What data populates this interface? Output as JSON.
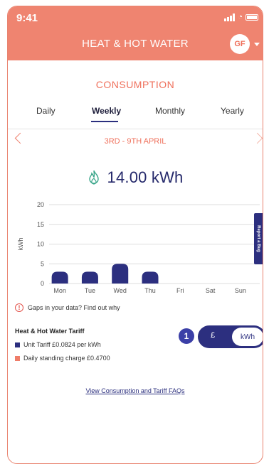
{
  "status_bar": {
    "time": "9:41"
  },
  "header": {
    "title": "HEAT & HOT WATER",
    "avatar_initials": "GF"
  },
  "section_title": "CONSUMPTION",
  "tabs": [
    {
      "label": "Daily",
      "active": false
    },
    {
      "label": "Weekly",
      "active": true
    },
    {
      "label": "Monthly",
      "active": false
    },
    {
      "label": "Yearly",
      "active": false
    }
  ],
  "date_range": "3RD - 9TH APRIL",
  "usage": {
    "value": "14.00 kWh",
    "icon": "flame-icon"
  },
  "chart_data": {
    "type": "bar",
    "categories": [
      "Mon",
      "Tue",
      "Wed",
      "Thu",
      "Fri",
      "Sat",
      "Sun"
    ],
    "values": [
      3,
      3,
      5,
      3,
      0,
      0,
      0
    ],
    "ylabel": "kWh",
    "yticks": [
      0,
      5,
      10,
      15,
      20
    ],
    "ylim": [
      0,
      20
    ],
    "grid": true,
    "bar_color": "#2c2f7f"
  },
  "gaps_notice": "Gaps in your data? Find out why",
  "tariff": {
    "title": "Heat & Hot Water Tariff",
    "unit_tariff": "Unit Tariff £0.0824 per kWh",
    "standing_charge": "Daily standing charge £0.4700",
    "unit_color": "#2c2f7f",
    "standing_color": "#ef7d69"
  },
  "unit_toggle": {
    "badge": "1",
    "pound_label": "£",
    "kwh_label": "kWh",
    "selected": "kWh"
  },
  "faq_link": "View Consumption and Tariff FAQs",
  "feedback_tab": "Report a Bug",
  "colors": {
    "accent": "#ef8470",
    "navy": "#2c2f7f"
  }
}
